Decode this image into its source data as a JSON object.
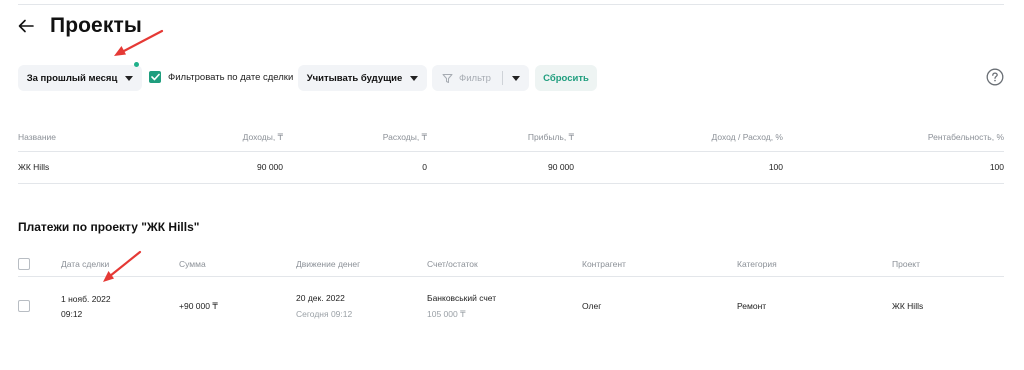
{
  "header": {
    "title": "Проекты"
  },
  "toolbar": {
    "period_label": "За прошлый месяц",
    "filter_by_date_label": "Фильтровать по дате сделки",
    "future_label": "Учитывать будущие",
    "filter_label": "Фильтр",
    "reset_label": "Сбросить"
  },
  "summary": {
    "columns": [
      "Название",
      "Доходы, ₸",
      "Расходы, ₸",
      "Прибыль, ₸",
      "Доход / Расход, %",
      "Рентабельность, %"
    ],
    "rows": [
      {
        "name": "ЖК Hills",
        "income": "90 000",
        "expenses": "0",
        "profit": "90 000",
        "ratio": "100",
        "profitability": "100"
      }
    ]
  },
  "payments": {
    "title": "Платежи по проекту \"ЖК Hills\"",
    "columns": [
      "Дата сделки",
      "Сумма",
      "Движение денег",
      "Счет/остаток",
      "Контрагент",
      "Категория",
      "Проект"
    ],
    "rows": [
      {
        "deal_date": "1 нояб. 2022",
        "deal_time": "09:12",
        "amount": "+90 000 ₸",
        "movement_date": "20 дек. 2022",
        "movement_sub": "Сегодня 09:12",
        "account": "Банковський счет",
        "balance": "105 000 ₸",
        "counterparty": "Олег",
        "category": "Ремонт",
        "project": "ЖК Hills"
      }
    ]
  },
  "colors": {
    "accent": "#1f9e7e",
    "positive": "#1fb08a",
    "annotation_arrow": "#e53935"
  }
}
